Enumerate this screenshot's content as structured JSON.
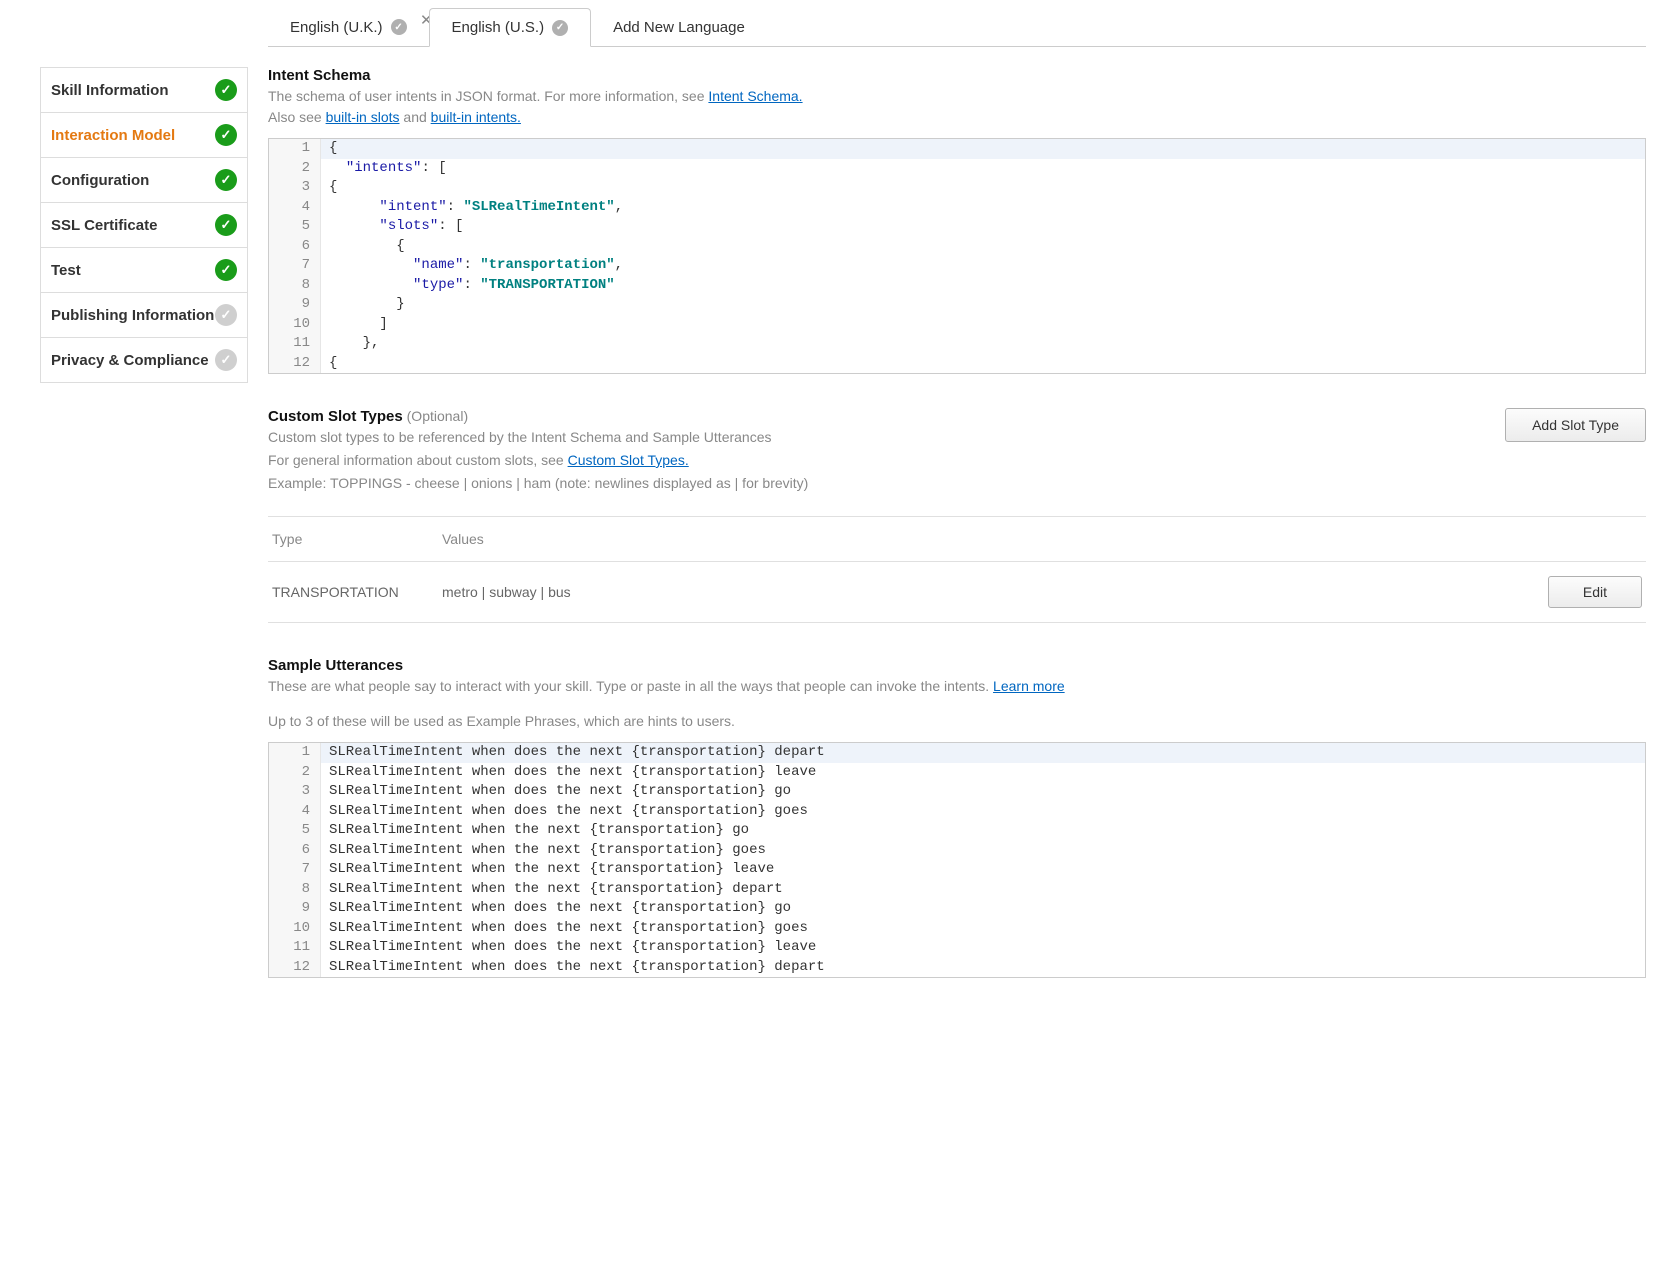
{
  "tabs": [
    {
      "label": "English (U.K.)",
      "status": "ok",
      "closable": true,
      "active": false
    },
    {
      "label": "English (U.S.)",
      "status": "ok",
      "closable": false,
      "active": true
    },
    {
      "label": "Add New Language",
      "status": null,
      "closable": false,
      "active": false,
      "add": true
    }
  ],
  "sidebar": [
    {
      "label": "Skill Information",
      "status": "ok",
      "active": false
    },
    {
      "label": "Interaction Model",
      "status": "ok",
      "active": true
    },
    {
      "label": "Configuration",
      "status": "ok",
      "active": false
    },
    {
      "label": "SSL Certificate",
      "status": "ok",
      "active": false
    },
    {
      "label": "Test",
      "status": "ok",
      "active": false
    },
    {
      "label": "Publishing Information",
      "status": "pending",
      "active": false
    },
    {
      "label": "Privacy & Compliance",
      "status": "pending",
      "active": false
    }
  ],
  "intent_schema": {
    "title": "Intent Schema",
    "desc_pre": "The schema of user intents in JSON format. For more information, see ",
    "desc_link": "Intent Schema.",
    "also_pre": "Also see ",
    "also_link1": "built-in slots",
    "also_mid": " and ",
    "also_link2": "built-in intents.",
    "code_tokens": [
      [
        [
          "punc",
          "{"
        ]
      ],
      [
        [
          "sp",
          "  "
        ],
        [
          "key",
          "\"intents\""
        ],
        [
          "punc",
          ": ["
        ]
      ],
      [
        [
          "punc",
          "{"
        ]
      ],
      [
        [
          "sp",
          "      "
        ],
        [
          "key",
          "\"intent\""
        ],
        [
          "punc",
          ": "
        ],
        [
          "str",
          "\"SLRealTimeIntent\""
        ],
        [
          "punc",
          ","
        ]
      ],
      [
        [
          "sp",
          "      "
        ],
        [
          "key",
          "\"slots\""
        ],
        [
          "punc",
          ": ["
        ]
      ],
      [
        [
          "sp",
          "        "
        ],
        [
          "punc",
          "{"
        ]
      ],
      [
        [
          "sp",
          "          "
        ],
        [
          "key",
          "\"name\""
        ],
        [
          "punc",
          ": "
        ],
        [
          "str",
          "\"transportation\""
        ],
        [
          "punc",
          ","
        ]
      ],
      [
        [
          "sp",
          "          "
        ],
        [
          "key",
          "\"type\""
        ],
        [
          "punc",
          ": "
        ],
        [
          "str",
          "\"TRANSPORTATION\""
        ]
      ],
      [
        [
          "sp",
          "        "
        ],
        [
          "punc",
          "}"
        ]
      ],
      [
        [
          "sp",
          "      "
        ],
        [
          "punc",
          "]"
        ]
      ],
      [
        [
          "sp",
          "    "
        ],
        [
          "punc",
          "},"
        ]
      ],
      [
        [
          "punc",
          "{"
        ]
      ]
    ]
  },
  "custom_slot": {
    "title": "Custom Slot Types",
    "optional": "(Optional)",
    "desc1": "Custom slot types to be referenced by the Intent Schema and Sample Utterances",
    "desc2_pre": "For general information about custom slots, see ",
    "desc2_link": "Custom Slot Types.",
    "desc3": "Example: TOPPINGS - cheese | onions | ham (note: newlines displayed as | for brevity)",
    "add_button": "Add Slot Type",
    "table": {
      "head_type": "Type",
      "head_values": "Values",
      "rows": [
        {
          "type": "TRANSPORTATION",
          "values": "metro | subway | bus",
          "edit": "Edit"
        }
      ]
    }
  },
  "utterances": {
    "title": "Sample Utterances",
    "desc_pre": "These are what people say to interact with your skill. Type or paste in all the ways that people can invoke the intents. ",
    "desc_link": "Learn more",
    "note": "Up to 3 of these will be used as Example Phrases, which are hints to users.",
    "lines": [
      "SLRealTimeIntent when does the next {transportation} depart",
      "SLRealTimeIntent when does the next {transportation} leave",
      "SLRealTimeIntent when does the next {transportation} go",
      "SLRealTimeIntent when does the next {transportation} goes",
      "SLRealTimeIntent when the next {transportation} go",
      "SLRealTimeIntent when the next {transportation} goes",
      "SLRealTimeIntent when the next {transportation} leave",
      "SLRealTimeIntent when the next {transportation} depart",
      "SLRealTimeIntent when does the next {transportation} go",
      "SLRealTimeIntent when does the next {transportation} goes",
      "SLRealTimeIntent when does the next {transportation} leave",
      "SLRealTimeIntent when does the next {transportation} depart"
    ]
  }
}
